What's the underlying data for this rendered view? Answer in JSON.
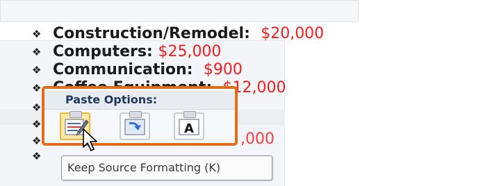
{
  "bullets": [
    {
      "label": "Construction/Remodel:",
      "value": "$20,000"
    },
    {
      "label": "Computers:",
      "value": "$25,000"
    },
    {
      "label": "Communication:",
      "value": "$900"
    },
    {
      "label": "Coffee Equipment:",
      "value": "$12,000"
    }
  ],
  "bullet_symbol": "❖",
  "partial_value_text": ",000",
  "paste_options": {
    "title": "Paste Options:",
    "buttons": [
      {
        "icon": "keep-source-formatting-icon"
      },
      {
        "icon": "merge-formatting-icon"
      },
      {
        "icon": "keep-text-only-icon",
        "glyph": "A"
      }
    ]
  },
  "tooltip": {
    "text": "Keep Source Formatting (K)"
  },
  "colors": {
    "accent_border": "#e26d1a",
    "value_text": "#ff1a1a",
    "title_text": "#1f3864",
    "selected_button": "#fde9a8"
  }
}
